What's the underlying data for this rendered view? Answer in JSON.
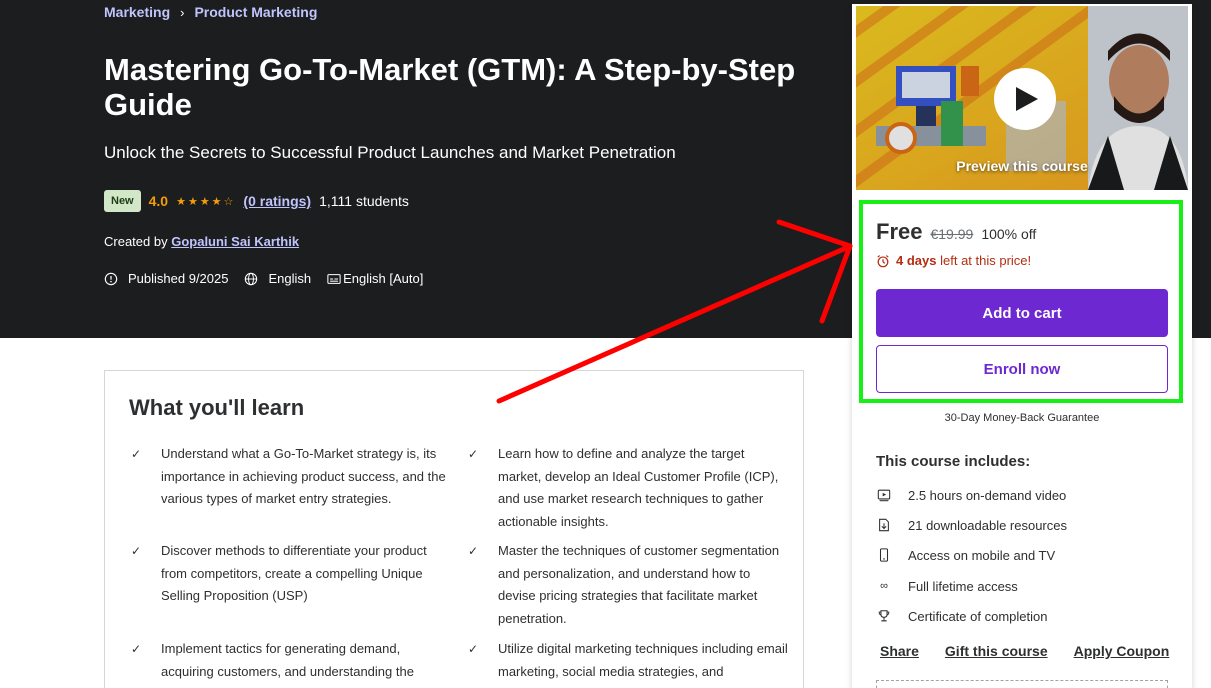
{
  "breadcrumb": {
    "items": [
      "Marketing",
      "Product Marketing"
    ],
    "separator": "›"
  },
  "course": {
    "title": "Mastering Go-To-Market (GTM): A Step-by-Step Guide",
    "subtitle": "Unlock the Secrets to Successful Product Launches and Market Penetration",
    "badge": "New",
    "rating": "4.0",
    "stars_filled": 4,
    "stars_total": 5,
    "ratings_link": "(0 ratings)",
    "students": "1,111 students",
    "created_by_label": "Created by",
    "author": "Gopaluni Sai Karthik",
    "published": "Published 9/2025",
    "language": "English",
    "captions": "English [Auto]"
  },
  "learn": {
    "heading": "What you'll learn",
    "items": [
      "Understand what a Go-To-Market strategy is, its importance in achieving product success, and the various types of market entry strategies.",
      "Learn how to define and analyze the target market, develop an Ideal Customer Profile (ICP), and use market research techniques to gather actionable insights.",
      "Discover methods to differentiate your product from competitors, create a compelling Unique Selling Proposition (USP)",
      "Master the techniques of customer segmentation and personalization, and understand how to devise pricing strategies that facilitate market penetration.",
      "Implement tactics for generating demand, acquiring customers, and understanding the",
      "Utilize digital marketing techniques including email marketing, social media strategies, and"
    ]
  },
  "sidebar": {
    "preview_label": "Preview this course",
    "price": "Free",
    "original_price": "€19.99",
    "discount": "100% off",
    "urgency_days": "4 days",
    "urgency_text": "left at this price!",
    "add_to_cart": "Add to cart",
    "enroll_now": "Enroll now",
    "guarantee": "30-Day Money-Back Guarantee",
    "includes_title": "This course includes:",
    "includes": [
      {
        "icon": "video-icon",
        "label": "2.5 hours on-demand video"
      },
      {
        "icon": "download-file-icon",
        "label": "21 downloadable resources"
      },
      {
        "icon": "mobile-icon",
        "label": "Access on mobile and TV"
      },
      {
        "icon": "infinity-icon",
        "label": "Full lifetime access"
      },
      {
        "icon": "trophy-icon",
        "label": "Certificate of completion"
      }
    ],
    "links": [
      "Share",
      "Gift this course",
      "Apply Coupon"
    ]
  },
  "colors": {
    "hero_bg": "#1c1d1f",
    "link_purple": "#c0c4fc",
    "star": "#f69c08",
    "primary": "#6d28d2",
    "urgency": "#b32d0f",
    "highlight_box": "#16f016",
    "annotation_arrow": "#ff0000"
  }
}
